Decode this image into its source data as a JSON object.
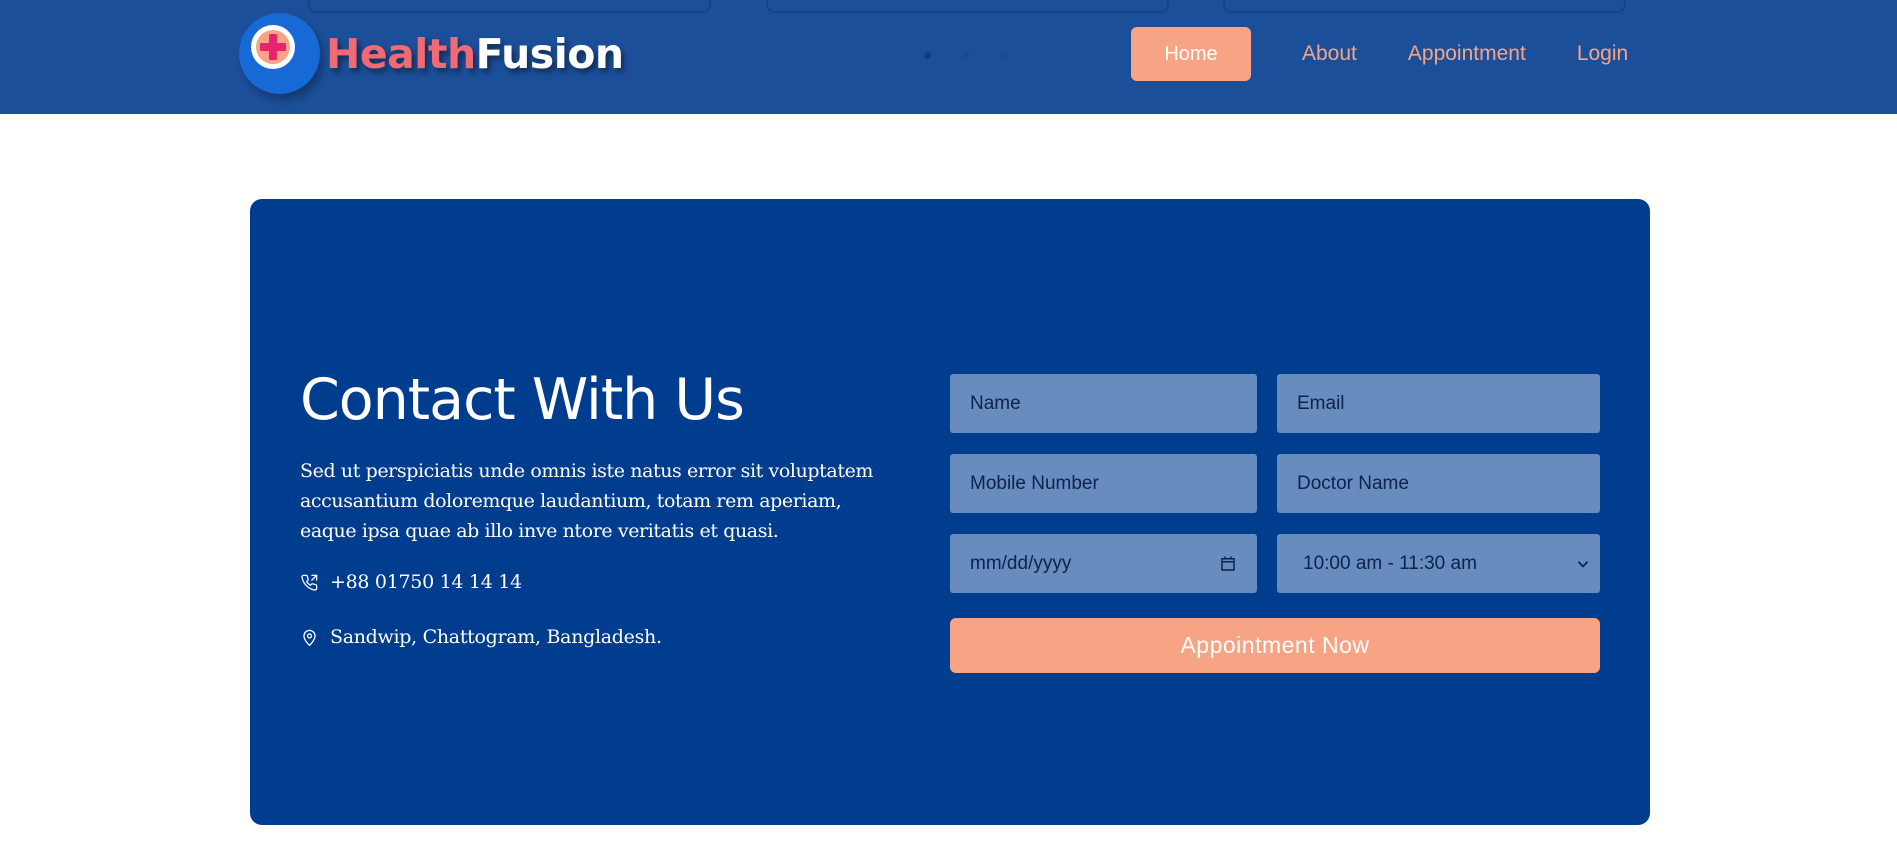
{
  "brand": {
    "name_part1": "Health",
    "name_part2": "Fusion",
    "logo_icon": "medical-cross-icon"
  },
  "nav": {
    "items": [
      {
        "label": "Home",
        "active": true
      },
      {
        "label": "About",
        "active": false
      },
      {
        "label": "Appointment",
        "active": false
      },
      {
        "label": "Login",
        "active": false
      }
    ]
  },
  "carousel": {
    "dot_count": 3,
    "active_index": 0
  },
  "contact": {
    "title": "Contact With Us",
    "description": "Sed ut perspiciatis unde omnis iste natus error sit voluptatem accusantium doloremque laudantium, totam rem aperiam, eaque ipsa quae ab illo inve ntore veritatis et quasi.",
    "phone": "+88 01750 14 14 14",
    "phone_icon": "phone-icon",
    "address": "Sandwip, Chattogram, Bangladesh.",
    "address_icon": "location-pin-icon"
  },
  "form": {
    "name_placeholder": "Name",
    "email_placeholder": "Email",
    "mobile_placeholder": "Mobile Number",
    "doctor_placeholder": "Doctor Name",
    "date_placeholder": "mm/dd/yyyy",
    "date_icon": "calendar-icon",
    "time_selected": "10:00 am - 11:30 am",
    "time_icon": "chevron-down-icon",
    "submit_label": "Appointment Now"
  },
  "colors": {
    "header_bg": "#1c4f9a",
    "card_bg": "#003d8f",
    "accent": "#f7a485",
    "field_bg": "#678cbd",
    "brand_pink": "#f06a76"
  }
}
